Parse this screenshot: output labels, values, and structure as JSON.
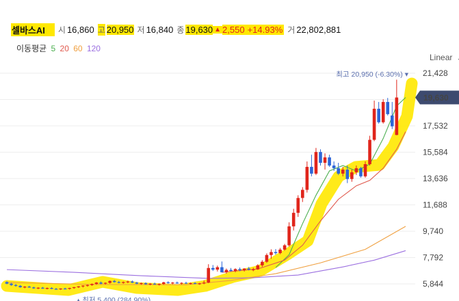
{
  "info": {
    "name": "셀바스AI",
    "open_label": "시",
    "open": "16,860",
    "high_label": "고",
    "high": "20,950",
    "low_label": "저",
    "low": "16,840",
    "close_label": "종",
    "close": "19,630",
    "change_arrow": "▲",
    "change": "2,550",
    "change_pct": "+14.93%",
    "volume_label": "거",
    "volume": "22,802,881"
  },
  "ma": {
    "label": "이동평균",
    "periods": [
      {
        "period": "5",
        "color": "#4caf50"
      },
      {
        "period": "20",
        "color": "#e05a4e"
      },
      {
        "period": "60",
        "color": "#f0a040"
      },
      {
        "period": "120",
        "color": "#9b6fe0"
      }
    ]
  },
  "scale_label": "Linear",
  "colors": {
    "up": "#e0251b",
    "down": "#2d66d8",
    "highlight": "#ffe800",
    "price_tag": "#3d4a6f"
  },
  "current_price_tag": "19,630",
  "chart_data": {
    "type": "candlestick",
    "y_ticks": [
      "21,428",
      "19,480",
      "17,532",
      "15,584",
      "13,636",
      "11,688",
      "9,740",
      "7,792",
      "5,844"
    ],
    "ylim": [
      5500,
      22000
    ],
    "annotations": {
      "max": "최고 20,950 (-6.30%)",
      "min": "최저 5,400 (284.90%)"
    },
    "candles": [
      [
        5980,
        6040,
        5820,
        5860
      ],
      [
        5860,
        5920,
        5700,
        5760
      ],
      [
        5760,
        5840,
        5640,
        5700
      ],
      [
        5700,
        5760,
        5560,
        5600
      ],
      [
        5600,
        5680,
        5520,
        5640
      ],
      [
        5640,
        5700,
        5560,
        5580
      ],
      [
        5580,
        5640,
        5480,
        5520
      ],
      [
        5520,
        5600,
        5460,
        5560
      ],
      [
        5560,
        5620,
        5480,
        5500
      ],
      [
        5500,
        5580,
        5440,
        5540
      ],
      [
        5540,
        5600,
        5460,
        5480
      ],
      [
        5480,
        5540,
        5420,
        5460
      ],
      [
        5460,
        5520,
        5400,
        5500
      ],
      [
        5500,
        5560,
        5440,
        5480
      ],
      [
        5480,
        5560,
        5420,
        5540
      ],
      [
        5540,
        5620,
        5480,
        5600
      ],
      [
        5600,
        5680,
        5540,
        5660
      ],
      [
        5660,
        5740,
        5580,
        5720
      ],
      [
        5720,
        5800,
        5640,
        5760
      ],
      [
        5760,
        5880,
        5700,
        5840
      ],
      [
        5840,
        5980,
        5780,
        5940
      ],
      [
        5940,
        6020,
        5820,
        5860
      ],
      [
        5860,
        5960,
        5800,
        5920
      ],
      [
        5920,
        6100,
        5860,
        6060
      ],
      [
        6060,
        6140,
        5940,
        5980
      ],
      [
        5980,
        6060,
        5880,
        5920
      ],
      [
        5920,
        6020,
        5860,
        5980
      ],
      [
        5980,
        6080,
        5900,
        6020
      ],
      [
        6020,
        6100,
        5900,
        5940
      ],
      [
        5940,
        6000,
        5820,
        5860
      ],
      [
        5860,
        5940,
        5780,
        5900
      ],
      [
        5900,
        5960,
        5780,
        5820
      ],
      [
        5820,
        5900,
        5740,
        5860
      ],
      [
        5860,
        5940,
        5780,
        5800
      ],
      [
        5800,
        5880,
        5720,
        5840
      ],
      [
        5840,
        6000,
        5780,
        5960
      ],
      [
        5960,
        6040,
        5860,
        5900
      ],
      [
        5900,
        5980,
        5820,
        5940
      ],
      [
        5940,
        6020,
        5860,
        5880
      ],
      [
        5880,
        5960,
        5800,
        5920
      ],
      [
        5920,
        6000,
        5840,
        5860
      ],
      [
        5860,
        5940,
        5800,
        5900
      ],
      [
        5900,
        5980,
        5820,
        5840
      ],
      [
        5840,
        5920,
        5780,
        5880
      ],
      [
        5880,
        6100,
        5820,
        5940
      ],
      [
        5940,
        7300,
        5900,
        7020
      ],
      [
        7020,
        7240,
        6800,
        6900
      ],
      [
        6900,
        7200,
        6760,
        7080
      ],
      [
        7080,
        7500,
        6980,
        6700
      ],
      [
        6700,
        6980,
        6600,
        6880
      ],
      [
        6880,
        7020,
        6740,
        6800
      ],
      [
        6800,
        7000,
        6700,
        6940
      ],
      [
        6940,
        7060,
        6780,
        6860
      ],
      [
        6860,
        7000,
        6760,
        6980
      ],
      [
        6980,
        7100,
        6840,
        6900
      ],
      [
        6900,
        7040,
        6780,
        6920
      ],
      [
        6920,
        7300,
        6880,
        7220
      ],
      [
        7220,
        7600,
        7100,
        7480
      ],
      [
        7480,
        8100,
        7400,
        7980
      ],
      [
        7980,
        8400,
        7700,
        8200
      ],
      [
        8200,
        8420,
        8000,
        8120
      ],
      [
        8120,
        8500,
        8040,
        8380
      ],
      [
        8380,
        8800,
        8300,
        8700
      ],
      [
        8700,
        10400,
        8600,
        10100
      ],
      [
        10100,
        11400,
        9800,
        11100
      ],
      [
        11100,
        12400,
        10800,
        12200
      ],
      [
        12200,
        13000,
        11900,
        12800
      ],
      [
        12800,
        14900,
        12600,
        14500
      ],
      [
        14500,
        15400,
        13800,
        14000
      ],
      [
        14000,
        15900,
        13900,
        15600
      ],
      [
        15600,
        15800,
        14600,
        14800
      ],
      [
        14800,
        15500,
        14300,
        15200
      ],
      [
        15200,
        15400,
        14500,
        14600
      ],
      [
        14600,
        14900,
        14200,
        14400
      ],
      [
        14400,
        14800,
        13900,
        14000
      ],
      [
        14000,
        14500,
        13800,
        14300
      ],
      [
        14300,
        14600,
        13300,
        13600
      ],
      [
        13600,
        14300,
        13400,
        14100
      ],
      [
        14100,
        14600,
        13900,
        14400
      ],
      [
        14400,
        14500,
        13700,
        13800
      ],
      [
        13800,
        14900,
        13700,
        14700
      ],
      [
        14700,
        16800,
        14600,
        16500
      ],
      [
        16500,
        19400,
        16400,
        18800
      ],
      [
        18800,
        19300,
        17700,
        17800
      ],
      [
        17800,
        19500,
        17700,
        19300
      ],
      [
        19300,
        19600,
        18300,
        18400
      ],
      [
        18300,
        19300,
        17300,
        17500
      ],
      [
        16860,
        20950,
        16840,
        19630
      ]
    ],
    "ma_series": {
      "5": [
        [
          60,
          7050
        ],
        [
          63,
          8000
        ],
        [
          66,
          10300
        ],
        [
          69,
          12400
        ],
        [
          72,
          14200
        ],
        [
          75,
          14600
        ],
        [
          78,
          14200
        ],
        [
          81,
          14700
        ],
        [
          84,
          16600
        ],
        [
          87,
          19000
        ],
        [
          89,
          19630
        ]
      ],
      "20": [
        [
          48,
          6700
        ],
        [
          56,
          6950
        ],
        [
          62,
          7600
        ],
        [
          66,
          8700
        ],
        [
          70,
          10500
        ],
        [
          74,
          12100
        ],
        [
          78,
          13100
        ],
        [
          81,
          13500
        ],
        [
          84,
          14400
        ],
        [
          87,
          15800
        ],
        [
          89,
          17100
        ]
      ],
      "60": [
        [
          0,
          5950
        ],
        [
          20,
          5800
        ],
        [
          40,
          5780
        ],
        [
          50,
          6100
        ],
        [
          60,
          6600
        ],
        [
          70,
          7400
        ],
        [
          80,
          8400
        ],
        [
          89,
          10100
        ]
      ],
      "120": [
        [
          0,
          6900
        ],
        [
          15,
          6700
        ],
        [
          30,
          6450
        ],
        [
          45,
          6250
        ],
        [
          55,
          6300
        ],
        [
          65,
          6500
        ],
        [
          75,
          7100
        ],
        [
          82,
          7600
        ],
        [
          89,
          8300
        ]
      ]
    }
  }
}
